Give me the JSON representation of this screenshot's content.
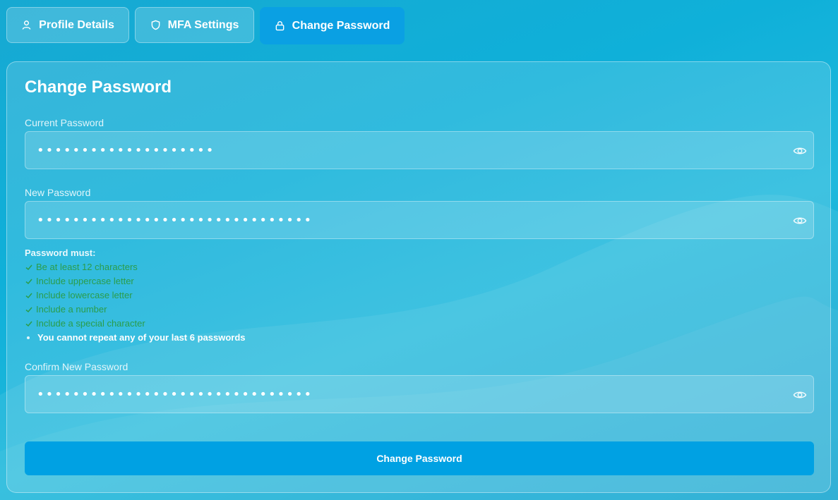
{
  "tabs": [
    {
      "label": "Profile Details",
      "icon": "user-icon"
    },
    {
      "label": "MFA Settings",
      "icon": "shield-icon"
    },
    {
      "label": "Change Password",
      "icon": "lock-icon",
      "active": true
    }
  ],
  "form": {
    "title": "Change Password",
    "current_label": "Current Password",
    "current_value": "••••••••••••••••••••",
    "new_label": "New Password",
    "new_value": "•••••••••••••••••••••••••••••••",
    "confirm_label": "Confirm New Password",
    "confirm_value": "•••••••••••••••••••••••••••••••",
    "submit_label": "Change Password"
  },
  "requirements": {
    "heading": "Password must:",
    "items": [
      {
        "text": "Be at least 12 characters",
        "met": true
      },
      {
        "text": "Include uppercase letter",
        "met": true
      },
      {
        "text": "Include lowercase letter",
        "met": true
      },
      {
        "text": "Include a number",
        "met": true
      },
      {
        "text": "Include a special character",
        "met": true
      }
    ],
    "note": "You cannot repeat any of your last 6 passwords"
  },
  "colors": {
    "accent": "#00a1e3",
    "success": "#2a9d4a"
  }
}
